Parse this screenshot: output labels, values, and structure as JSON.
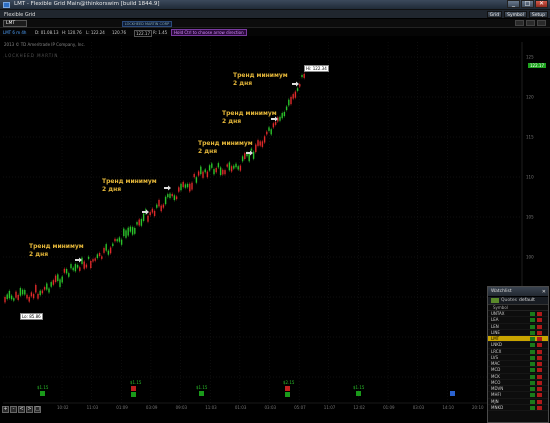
{
  "window": {
    "title": "LMT - Flexible Grid Main@thinkorswim [build 1844.9]"
  },
  "toolbar": {
    "label": "Flexible Grid",
    "buttons": [
      "Grid",
      "Symbol",
      "Setup"
    ],
    "window_buttons": [
      "_",
      "□",
      "✕"
    ]
  },
  "symbol_bar": {
    "symbol": "LMT",
    "company": "LOCKHEED MARTIN CORP",
    "right_tools": [
      "Style",
      "Drawings",
      "Studies"
    ]
  },
  "quote": {
    "period": "LMT 6 m 4h",
    "open": "D: 01.08.13",
    "high": "H: 120.76",
    "low": "L: 122.24",
    "close": "120.76",
    "last": "122.17",
    "range": "R: 1.45",
    "hint": "Hold Ctrl to choose arrow direction"
  },
  "chart": {
    "copyright": "2013 © TD Ameritrade IP Company, Inc.",
    "watermark": "LOCKHEED MARTIN",
    "last_price_label": "122.17",
    "high_tag": "Hi: 122.34",
    "low_tag": "Lo: 85.86",
    "annotations": [
      {
        "line1": "Тренд минимум",
        "line2": "2 дня"
      },
      {
        "line1": "Тренд минимум",
        "line2": "2 дня"
      },
      {
        "line1": "Тренд минимум",
        "line2": "2 дня"
      },
      {
        "line1": "Тренд минимум",
        "line2": "2 дня"
      },
      {
        "line1": "Тренд минимум",
        "line2": "2 дня"
      }
    ],
    "price_ticks": [
      "125",
      "120",
      "115",
      "110",
      "105",
      "100",
      "95",
      "90",
      "85"
    ],
    "time_ticks": [
      "10:02",
      "11:03",
      "01:09",
      "03:09",
      "09:03",
      "11:03",
      "01:03",
      "03:03",
      "05:07",
      "11:07",
      "12:02",
      "01:09",
      "03:03",
      "14:10",
      "20:10"
    ],
    "dividends": [
      "$1.15",
      "$1.15",
      "$1.15",
      "$2.15",
      "$1.15"
    ],
    "colors": {
      "up": "#2bc42b",
      "down": "#e02a2a",
      "annotation": "#e6b83a",
      "background": "#000000"
    }
  },
  "nav_buttons": [
    "+",
    "-",
    "<",
    ">",
    "□"
  ],
  "gadget": {
    "title": "Watchlist",
    "close": "✕",
    "tab1": "Quotes",
    "tab2": "default",
    "column": "Symbol",
    "rows": [
      "UNTAX",
      "LEA",
      "LEN",
      "LINE",
      "LMT",
      "LNKD",
      "LRCX",
      "LVS",
      "MAC",
      "MCD",
      "MCK",
      "MCO",
      "MDVN",
      "MHFI",
      "MJN",
      "MNKD"
    ],
    "selected": "LMT"
  }
}
